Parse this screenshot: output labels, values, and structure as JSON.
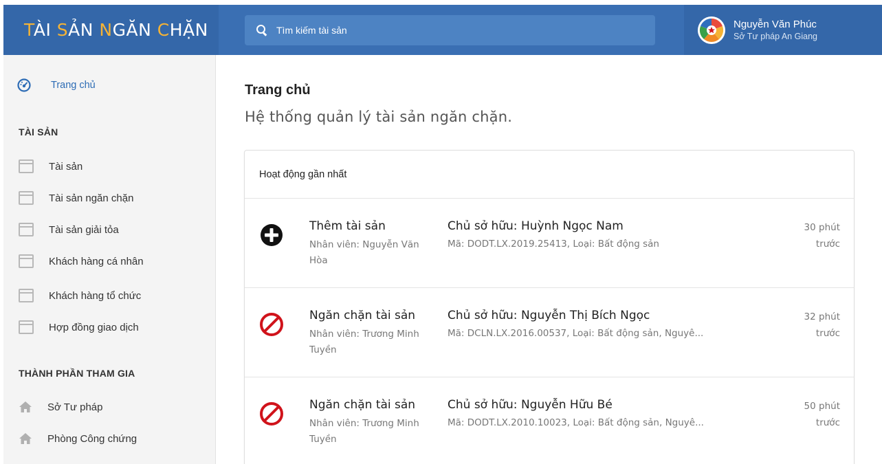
{
  "app": {
    "logo_words": [
      "TÀI",
      "SẢN",
      "NGĂN",
      "CHẶN"
    ],
    "logo_color": "#ffffff",
    "logo_accent_color": "#f5b335",
    "header_color": "#3a6fb3"
  },
  "search": {
    "placeholder": "Tìm kiếm tài sản",
    "icon": "search-icon"
  },
  "user": {
    "name": "Nguyễn Văn Phúc",
    "organization": "Sở Tư pháp An Giang",
    "avatar_icon": "logo-avatar"
  },
  "sidebar": {
    "home": {
      "label": "Trang chủ",
      "icon": "dashboard-icon",
      "color": "#2d6cb5"
    },
    "sections": [
      {
        "title": "TÀI SẢN",
        "items": [
          {
            "label": "Tài sản",
            "icon": "window-icon"
          },
          {
            "label": "Tài sản ngăn chặn",
            "icon": "window-icon"
          },
          {
            "label": "Tài sản giải tỏa",
            "icon": "window-icon"
          },
          {
            "label": "Khách hàng cá nhân",
            "icon": "window-icon"
          },
          {
            "label": "Khách hàng tổ chức",
            "icon": "window-icon"
          },
          {
            "label": "Hợp đồng giao dịch",
            "icon": "window-icon"
          }
        ]
      },
      {
        "title": "THÀNH PHẦN THAM GIA",
        "items": [
          {
            "label": "Sở Tư pháp",
            "icon": "home-icon"
          },
          {
            "label": "Phòng Công chứng",
            "icon": "home-icon"
          }
        ]
      }
    ]
  },
  "main": {
    "title": "Trang chủ",
    "subtitle": "Hệ thống quản lý tài sản ngăn chặn.",
    "activity": {
      "heading": "Hoạt động gần nhất",
      "rows": [
        {
          "icon": "plus-circle-icon",
          "action": "Thêm tài sản",
          "staff": "Nhân viên: Nguyễn Văn Hòa",
          "owner": "Chủ sở hữu: Huỳnh Ngọc Nam",
          "detail": "Mã: DODT.LX.2019.25413, Loại: Bất động sản",
          "time": "30 phút trước"
        },
        {
          "icon": "block-icon",
          "action": "Ngăn chặn tài sản",
          "staff": "Nhân viên: Trương Minh Tuyền",
          "owner": "Chủ sở hữu: Nguyễn Thị Bích Ngọc",
          "detail": "Mã: DCLN.LX.2016.00537, Loại: Bất động sản, Nguyê...",
          "time": "32 phút trước"
        },
        {
          "icon": "block-icon",
          "action": "Ngăn chặn tài sản",
          "staff": "Nhân viên: Trương Minh Tuyền",
          "owner": "Chủ sở hữu: Nguyễn Hữu Bé",
          "detail": "Mã: DODT.LX.2010.10023, Loại: Bất động sản, Nguyê...",
          "time": "50 phút trước"
        }
      ]
    }
  },
  "colors": {
    "block_red": "#d0131b",
    "link_blue": "#2d6cb5"
  }
}
